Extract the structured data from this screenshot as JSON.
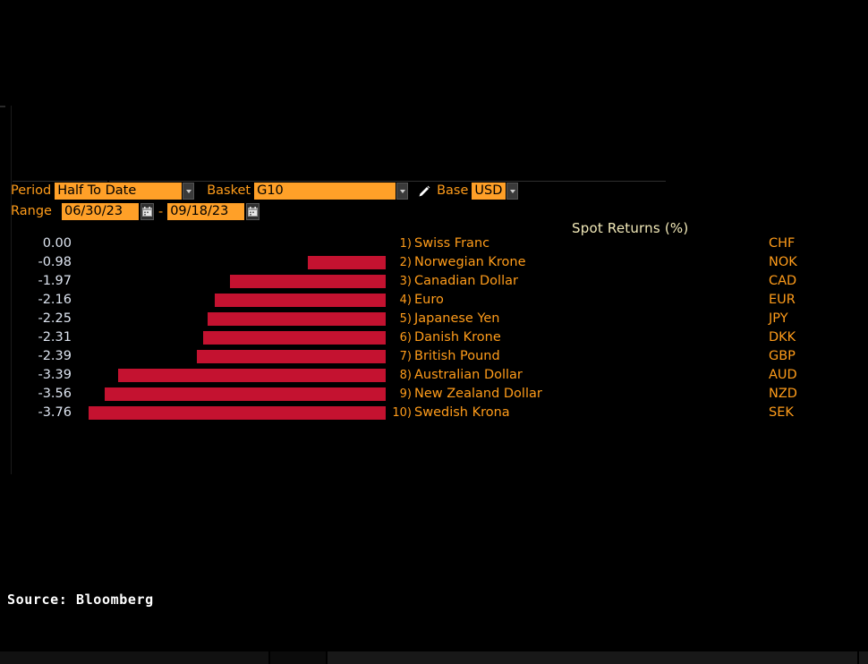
{
  "controls": {
    "period_label": "Period",
    "period_value": "Half To Date",
    "basket_label": "Basket",
    "basket_value": "G10",
    "base_label": "Base",
    "base_value": "USD",
    "range_label": "Range",
    "range_start": "06/30/23",
    "range_end": "09/18/23",
    "range_separator": "-",
    "edit_icon": "pencil-icon",
    "dropdown_icon": "chevron-down-icon",
    "calendar_icon": "calendar-icon"
  },
  "footer": {
    "source": "Source: Bloomberg"
  },
  "colors": {
    "accent_orange": "#ffa028",
    "bar_red": "#c41230",
    "value_text": "#dde4f0",
    "title_text": "#f2e9b8",
    "background": "#000000"
  },
  "chart_data": {
    "type": "bar",
    "title": "Spot Returns (%)",
    "xlabel": "",
    "ylabel": "",
    "orientation": "horizontal",
    "grid": false,
    "legend": "none",
    "xlim": [
      -3.76,
      0
    ],
    "unit": "%",
    "base_currency": "USD",
    "period": "Half To Date",
    "date_range": "06/30/23 - 09/18/23",
    "categories": [
      "Swiss Franc",
      "Norwegian Krone",
      "Canadian Dollar",
      "Euro",
      "Japanese Yen",
      "Danish Krone",
      "British Pound",
      "Australian Dollar",
      "New Zealand Dollar",
      "Swedish Krona"
    ],
    "values": [
      0.0,
      -0.98,
      -1.97,
      -2.16,
      -2.25,
      -2.31,
      -2.39,
      -3.39,
      -3.56,
      -3.76
    ],
    "rows": [
      {
        "rank": "1)",
        "value": "0.00",
        "value_num": 0.0,
        "name": "Swiss Franc",
        "code": "CHF"
      },
      {
        "rank": "2)",
        "value": "-0.98",
        "value_num": -0.98,
        "name": "Norwegian Krone",
        "code": "NOK"
      },
      {
        "rank": "3)",
        "value": "-1.97",
        "value_num": -1.97,
        "name": "Canadian Dollar",
        "code": "CAD"
      },
      {
        "rank": "4)",
        "value": "-2.16",
        "value_num": -2.16,
        "name": "Euro",
        "code": "EUR"
      },
      {
        "rank": "5)",
        "value": "-2.25",
        "value_num": -2.25,
        "name": "Japanese Yen",
        "code": "JPY"
      },
      {
        "rank": "6)",
        "value": "-2.31",
        "value_num": -2.31,
        "name": "Danish Krone",
        "code": "DKK"
      },
      {
        "rank": "7)",
        "value": "-2.39",
        "value_num": -2.39,
        "name": "British Pound",
        "code": "GBP"
      },
      {
        "rank": "8)",
        "value": "-3.39",
        "value_num": -3.39,
        "name": "Australian Dollar",
        "code": "AUD"
      },
      {
        "rank": "9)",
        "value": "-3.56",
        "value_num": -3.56,
        "name": "New Zealand Dollar",
        "code": "NZD"
      },
      {
        "rank": "10)",
        "value": "-3.76",
        "value_num": -3.76,
        "name": "Swedish Krona",
        "code": "SEK"
      }
    ]
  }
}
